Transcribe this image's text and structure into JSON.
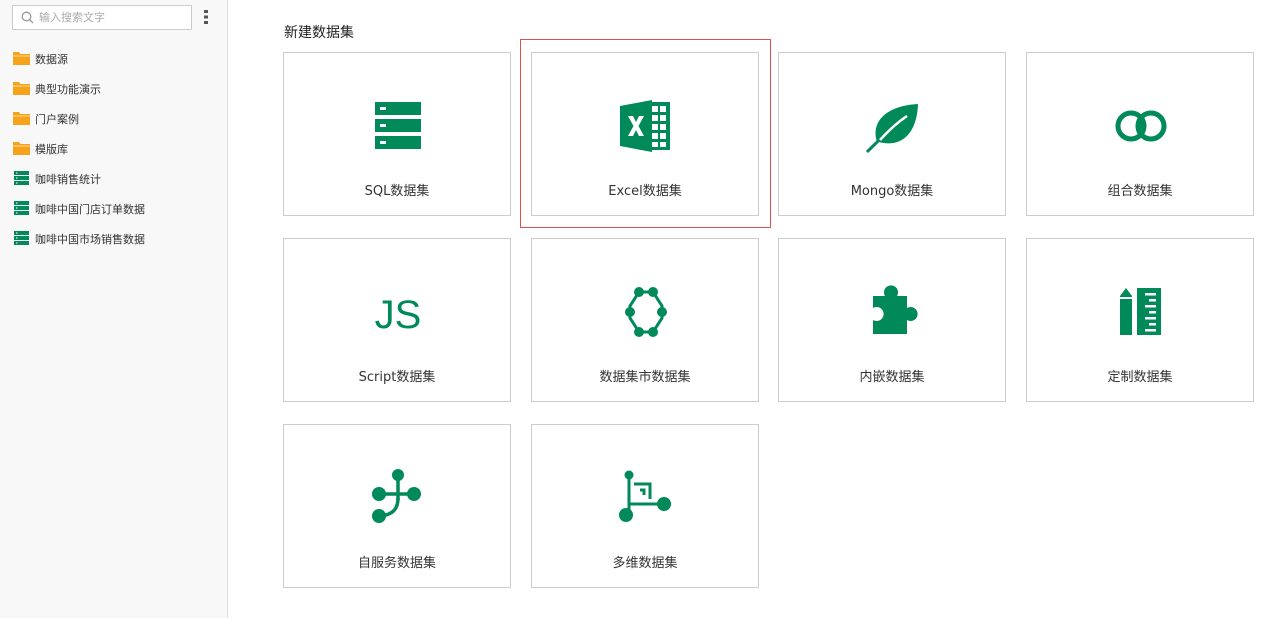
{
  "colors": {
    "accent": "#008a5a",
    "folder": "#f5a31a",
    "highlight": "#d9534f"
  },
  "sidebar": {
    "search": {
      "placeholder": "输入搜索文字",
      "value": ""
    },
    "menu_icon": "vertical-menu-icon",
    "items": [
      {
        "label": "数据源",
        "icon": "folder-icon"
      },
      {
        "label": "典型功能演示",
        "icon": "folder-icon"
      },
      {
        "label": "门户案例",
        "icon": "folder-icon"
      },
      {
        "label": "模版库",
        "icon": "folder-icon"
      },
      {
        "label": "咖啡销售统计",
        "icon": "dataset-icon"
      },
      {
        "label": "咖啡中国门店订单数据",
        "icon": "dataset-icon"
      },
      {
        "label": "咖啡中国市场销售数据",
        "icon": "dataset-icon"
      }
    ]
  },
  "main": {
    "title": "新建数据集",
    "cards": [
      {
        "label": "SQL数据集",
        "icon": "database-icon"
      },
      {
        "label": "Excel数据集",
        "icon": "excel-icon",
        "selected": true
      },
      {
        "label": "Mongo数据集",
        "icon": "leaf-icon"
      },
      {
        "label": "组合数据集",
        "icon": "combine-icon"
      },
      {
        "label": "Script数据集",
        "icon": "js-icon",
        "icon_text": "JS"
      },
      {
        "label": "数据集市数据集",
        "icon": "network-icon"
      },
      {
        "label": "内嵌数据集",
        "icon": "puzzle-icon"
      },
      {
        "label": "定制数据集",
        "icon": "custom-icon"
      },
      {
        "label": "自服务数据集",
        "icon": "self-service-icon"
      },
      {
        "label": "多维数据集",
        "icon": "cube-icon"
      }
    ]
  }
}
